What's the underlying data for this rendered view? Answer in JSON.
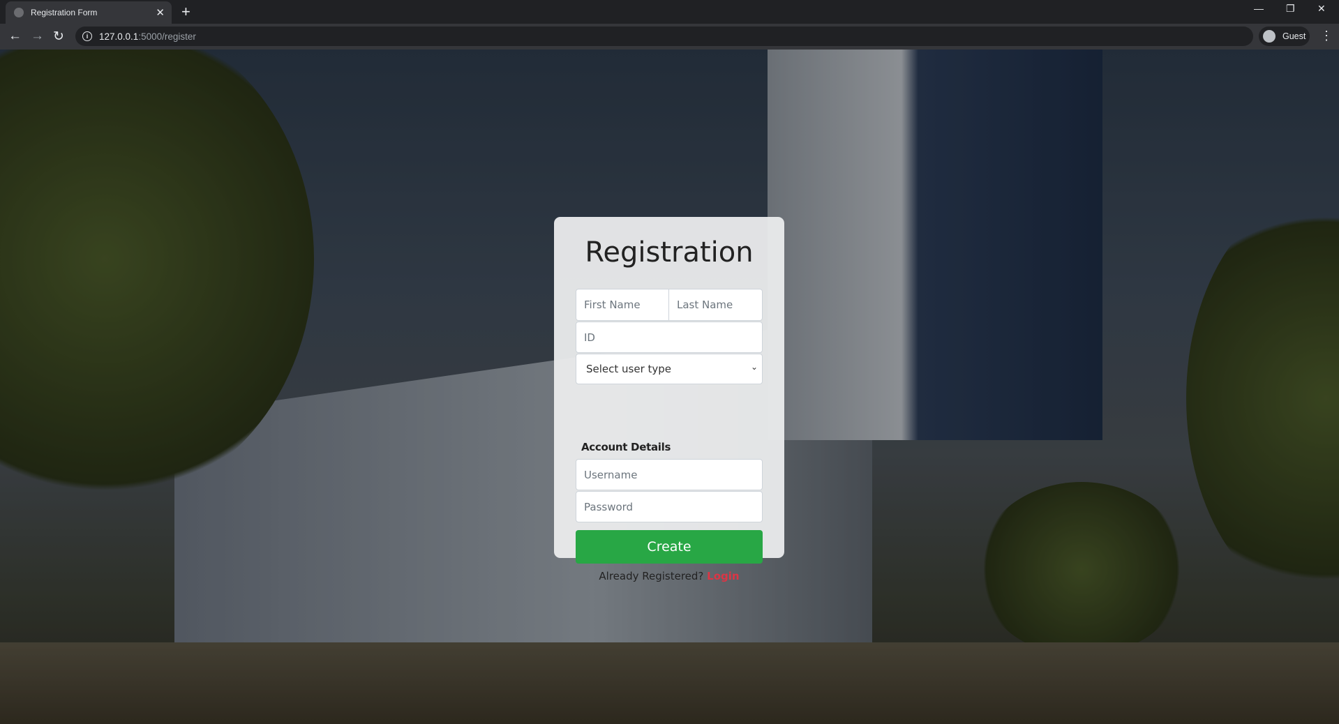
{
  "browser": {
    "tab_title": "Registration Form",
    "url_host": "127.0.0.1",
    "url_rest": ":5000/register",
    "profile": "Guest"
  },
  "form": {
    "title": "Registration",
    "first_name_placeholder": "First Name",
    "last_name_placeholder": "Last Name",
    "id_placeholder": "ID",
    "user_type_selected": "Select user type",
    "section_label": "Account Details",
    "username_placeholder": "Username",
    "password_placeholder": "Password",
    "create_label": "Create",
    "already_text": "Already Registered?",
    "login_label": "Login"
  },
  "colors": {
    "create": "#28a745",
    "login": "#dc3545"
  }
}
